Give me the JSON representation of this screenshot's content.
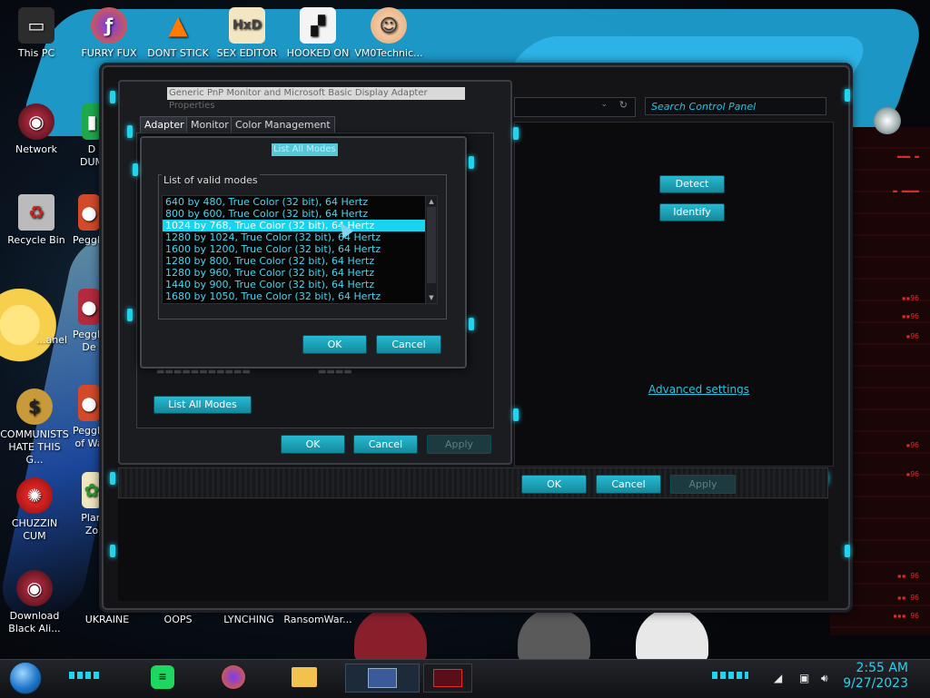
{
  "desktop": {
    "icons": [
      {
        "label": "This PC"
      },
      {
        "label": "FURRY FUX"
      },
      {
        "label": "DONT STICK"
      },
      {
        "label": "SEX EDITOR"
      },
      {
        "label": "HOOKED ON"
      },
      {
        "label": "VM0Technic..."
      },
      {
        "label": "Network"
      },
      {
        "label": "D\nDUM"
      },
      {
        "label": "Recycle Bin"
      },
      {
        "label": "Peggle"
      },
      {
        "label": "...anel"
      },
      {
        "label": "Peggle\nDe"
      },
      {
        "label": "COMMUNISTS HATE THIS G..."
      },
      {
        "label": "Peggle\nof Wa"
      },
      {
        "label": "CHUZZIN CUM"
      },
      {
        "label": "Plan\nZo"
      },
      {
        "label": "Download Black Ali..."
      },
      {
        "label": "UKRAINE"
      },
      {
        "label": "OOPS"
      },
      {
        "label": "LYNCHING"
      },
      {
        "label": "RansomWar..."
      }
    ]
  },
  "control_panel": {
    "search_placeholder": "Search Control Panel",
    "detect_label": "Detect",
    "identify_label": "Identify",
    "advanced_settings": "Advanced settings",
    "ok": "OK",
    "cancel": "Cancel",
    "apply": "Apply"
  },
  "properties": {
    "title": "Generic PnP Monitor and Microsoft Basic Display Adapter Properties",
    "tabs": [
      "Adapter",
      "Monitor",
      "Color Management"
    ],
    "list_all_modes": "List All Modes",
    "ok": "OK",
    "cancel": "Cancel",
    "apply": "Apply"
  },
  "modes_dialog": {
    "title": "List All Modes",
    "group_label": "List of valid modes",
    "modes": [
      "640 by 480, True Color (32 bit), 64 Hertz",
      "800 by 600, True Color (32 bit), 64 Hertz",
      "1024 by 768, True Color (32 bit), 64 Hertz",
      "1280 by 1024, True Color (32 bit), 64 Hertz",
      "1600 by 1200, True Color (32 bit), 64 Hertz",
      "1280 by 800, True Color (32 bit), 64 Hertz",
      "1280 by 960, True Color (32 bit), 64 Hertz",
      "1440 by 900, True Color (32 bit), 64 Hertz",
      "1680 by 1050, True Color (32 bit), 64 Hertz"
    ],
    "selected_index": 2,
    "ok": "OK",
    "cancel": "Cancel"
  },
  "taskbar": {
    "time": "2:55 AM",
    "date": "9/27/2023"
  },
  "colors": {
    "accent_cyan": "#22d3ee",
    "alert_red": "#e12a2a"
  }
}
